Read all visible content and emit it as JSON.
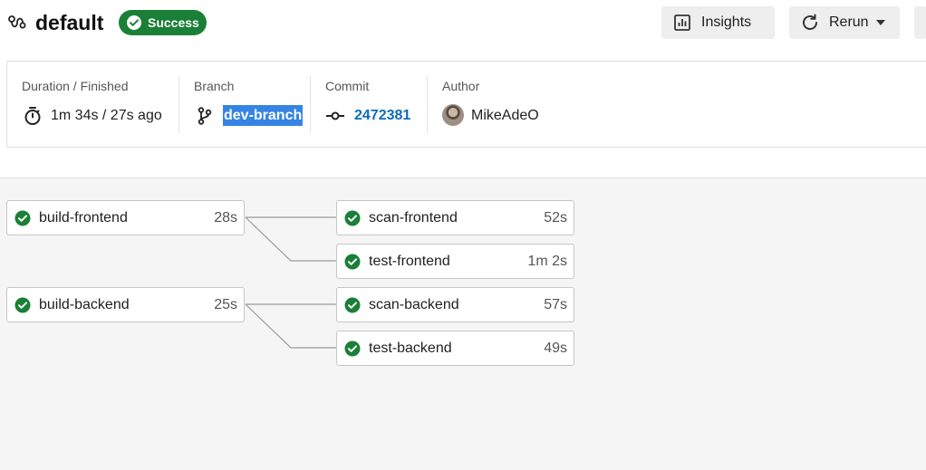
{
  "header": {
    "workflow_title": "default",
    "status_badge": "Success",
    "insights_label": "Insights",
    "rerun_label": "Rerun"
  },
  "summary": {
    "duration_label": "Duration / Finished",
    "duration_value": "1m 34s / 27s ago",
    "branch_label": "Branch",
    "branch_value": "dev-branch",
    "commit_label": "Commit",
    "commit_value": "2472381",
    "author_label": "Author",
    "author_value": "MikeAdeO"
  },
  "jobs": [
    {
      "name": "build-frontend",
      "duration": "28s",
      "status": "success"
    },
    {
      "name": "scan-frontend",
      "duration": "52s",
      "status": "success"
    },
    {
      "name": "test-frontend",
      "duration": "1m 2s",
      "status": "success"
    },
    {
      "name": "build-backend",
      "duration": "25s",
      "status": "success"
    },
    {
      "name": "scan-backend",
      "duration": "57s",
      "status": "success"
    },
    {
      "name": "test-backend",
      "duration": "49s",
      "status": "success"
    }
  ],
  "colors": {
    "success": "#1a7f37",
    "link": "#0b6bbd",
    "selection": "#3584e4"
  },
  "icons": {
    "workflow": "workflow-icon",
    "success": "check-circle-icon",
    "insights": "bar-chart-icon",
    "rerun": "refresh-icon",
    "duration": "stopwatch-icon",
    "branch": "git-branch-icon",
    "commit": "git-commit-icon"
  }
}
